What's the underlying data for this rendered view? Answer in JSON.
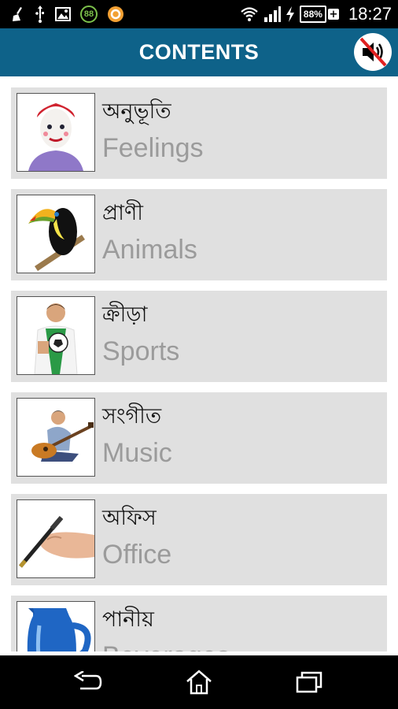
{
  "status_bar": {
    "notification_icons": [
      "broom-icon",
      "usb-icon",
      "image-icon",
      "battery-88-badge-icon",
      "orange-app-icon"
    ],
    "badge_text": "88",
    "battery_percent": "88%",
    "time": "18:27"
  },
  "app_bar": {
    "title": "CONTENTS",
    "sound_icon": "speaker-muted-icon"
  },
  "categories": [
    {
      "native": "অনুভূতি",
      "english": "Feelings",
      "image": "mime-face-icon"
    },
    {
      "native": "প্রাণী",
      "english": "Animals",
      "image": "toucan-icon"
    },
    {
      "native": "ক্রীড়া",
      "english": "Sports",
      "image": "soccer-player-icon"
    },
    {
      "native": "সংগীত",
      "english": "Music",
      "image": "guitar-player-icon"
    },
    {
      "native": "অফিস",
      "english": "Office",
      "image": "hand-pen-icon"
    },
    {
      "native": "পানীয়",
      "english": "Beverages",
      "image": "blue-jug-icon"
    }
  ],
  "nav_bar": {
    "icons": [
      "back-icon",
      "home-icon",
      "recent-apps-icon"
    ]
  },
  "colors": {
    "app_bar": "#0e6289",
    "item_bg": "#e0e0e0",
    "english_text": "#9b9b9b"
  }
}
